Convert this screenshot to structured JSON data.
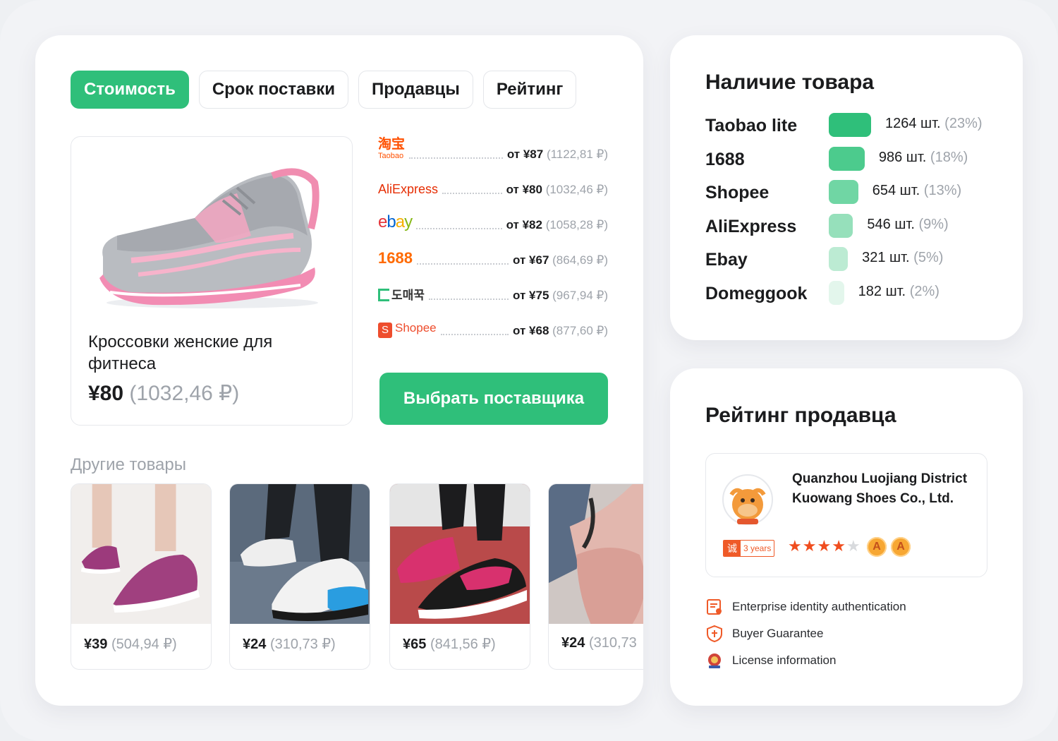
{
  "tabs": [
    {
      "label": "Стоимость",
      "active": true
    },
    {
      "label": "Срок поставки",
      "active": false
    },
    {
      "label": "Продавцы",
      "active": false
    },
    {
      "label": "Рейтинг",
      "active": false
    }
  ],
  "product": {
    "title": "Кроссовки женские для фитнеса",
    "price": "¥80",
    "price_converted": "(1032,46 ₽)"
  },
  "suppliers": [
    {
      "logo": "淘宝",
      "logo_sub": "Taobao",
      "color": "#ff5000",
      "price": "от ¥87",
      "converted": "(1122,81 ₽)"
    },
    {
      "logo": "AliExpress",
      "color": "#e62e04",
      "price": "от ¥80",
      "converted": "(1032,46 ₽)"
    },
    {
      "logo": "ebay",
      "color": "#0064d2",
      "price": "от ¥82",
      "converted": "(1058,28 ₽)"
    },
    {
      "logo": "1688",
      "color": "#ff6a00",
      "price": "от ¥67",
      "converted": "(864,69 ₽)"
    },
    {
      "logo": "도매꾹",
      "color": "#1d8a3a",
      "price": "от ¥75",
      "converted": "(967,94 ₽)"
    },
    {
      "logo": "Shopee",
      "color": "#ee4d2d",
      "price": "от ¥68",
      "converted": "(877,60 ₽)"
    }
  ],
  "choose_button": "Выбрать поставщика",
  "other_title": "Другие товары",
  "other_products": [
    {
      "price": "¥39",
      "converted": "(504,94 ₽)"
    },
    {
      "price": "¥24",
      "converted": "(310,73 ₽)"
    },
    {
      "price": "¥65",
      "converted": "(841,56 ₽)"
    },
    {
      "price": "¥24",
      "converted": "(310,73"
    }
  ],
  "stock": {
    "title": "Наличие товара",
    "rows": [
      {
        "name": "Taobao lite",
        "count": "1264 шт.",
        "pct": "(23%)",
        "share": 0.23,
        "color": "#2fbf7a"
      },
      {
        "name": "1688",
        "count": "986 шт.",
        "pct": "(18%)",
        "share": 0.18,
        "color": "#4ccb8d"
      },
      {
        "name": "Shopee",
        "count": "654 шт.",
        "pct": "(13%)",
        "share": 0.13,
        "color": "#70d6a4"
      },
      {
        "name": "AliExpress",
        "count": "546 шт.",
        "pct": "(9%)",
        "share": 0.09,
        "color": "#96e0bb"
      },
      {
        "name": "Ebay",
        "count": "321 шт.",
        "pct": "(5%)",
        "share": 0.05,
        "color": "#bcebd3"
      },
      {
        "name": "Domeggook",
        "count": "182 шт.",
        "pct": "(2%)",
        "share": 0.02,
        "color": "#e3f6ec"
      }
    ]
  },
  "seller_rating": {
    "title": "Рейтинг продавца",
    "seller_name": "Quanzhou Luojiang District Kuowang Shoes Co., Ltd.",
    "badge_cn": "诚",
    "badge_years": "3 years",
    "stars": 4,
    "stars_max": 5,
    "medal_letter": "A",
    "features": [
      {
        "icon": "certificate-icon",
        "label": "Enterprise identity authentication"
      },
      {
        "icon": "guarantee-icon",
        "label": "Buyer Guarantee"
      },
      {
        "icon": "license-icon",
        "label": "License information"
      }
    ]
  }
}
